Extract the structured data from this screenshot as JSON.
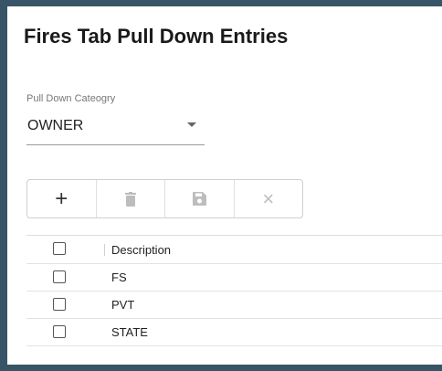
{
  "page": {
    "title": "Fires Tab Pull Down Entries"
  },
  "category": {
    "label": "Pull Down Cateogry",
    "value": "OWNER"
  },
  "toolbar": {
    "add_icon": "plus-icon",
    "add_glyph": "+",
    "delete_icon": "trash-icon",
    "save_icon": "floppy-disk-icon",
    "cancel_icon": "close-icon",
    "cancel_glyph": "×"
  },
  "grid": {
    "columns": [
      "Description"
    ],
    "rows": [
      "FS",
      "PVT",
      "STATE"
    ]
  },
  "colors": {
    "frame": "#375566",
    "panel": "#ffffff",
    "disabled_icon": "#bdbdbd"
  }
}
